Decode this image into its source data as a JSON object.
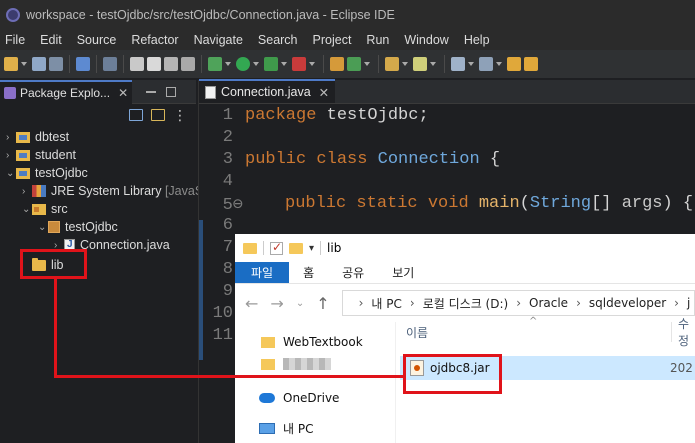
{
  "window": {
    "title": "workspace - testOjdbc/src/testOjdbc/Connection.java - Eclipse IDE"
  },
  "menu": [
    "File",
    "Edit",
    "Source",
    "Refactor",
    "Navigate",
    "Search",
    "Project",
    "Run",
    "Window",
    "Help"
  ],
  "package_explorer": {
    "tab_label": "Package Explo...",
    "close": "✕",
    "items": {
      "dbtest": "dbtest",
      "student": "student",
      "testOjdbc": "testOjdbc",
      "jre": "JRE System Library",
      "jre_suffix": "[JavaSE",
      "src": "src",
      "pkg": "testOjdbc",
      "file": "Connection.java",
      "lib": "lib"
    }
  },
  "editor": {
    "tab_label": "Connection.java",
    "close": "✕",
    "line_numbers": [
      "1",
      "2",
      "3",
      "4",
      "5⊖",
      "6",
      "7",
      "8",
      "9",
      "10",
      "11"
    ],
    "code": {
      "l1_kw": "package",
      "l1_rest": " testOjdbc;",
      "l3_kw1": "public",
      "l3_kw2": "class",
      "l3_cls": "Connection",
      "l3_brace": " {",
      "l5_kw1": "public",
      "l5_kw2": "static",
      "l5_kw3": "void",
      "l5_fn": "main",
      "l5_paren": "(",
      "l5_type": "String",
      "l5_arr": "[] ",
      "l5_param": "args",
      "l5_end": ") {"
    }
  },
  "explorer": {
    "title": "lib",
    "ribbon": [
      "파일",
      "홈",
      "공유",
      "보기"
    ],
    "address": [
      "내 PC",
      "로컬 디스크 (D:)",
      "Oracle",
      "sqldeveloper",
      "j"
    ],
    "nav": {
      "webtextbook": "WebTextbook",
      "onedrive": "OneDrive",
      "mypc": "내 PC"
    },
    "column_name": "이름",
    "column_date": "수정",
    "file": {
      "name": "ojdbc8.jar",
      "date": "202"
    }
  },
  "colors": {
    "annotation": "#e0131a",
    "ribbon_file": "#1a6dc4",
    "selection": "#cce8ff"
  }
}
